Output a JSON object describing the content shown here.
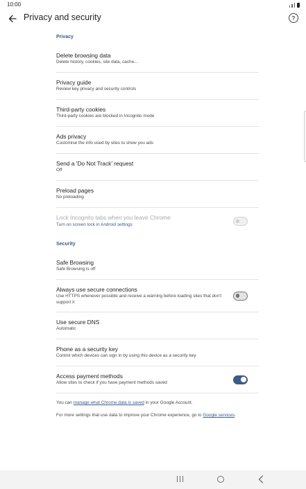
{
  "status_bar": {
    "time": "10:00"
  },
  "app_bar": {
    "title": "Privacy and security",
    "back_icon": "arrow-left-icon",
    "help_icon": "help-circle-icon",
    "help_glyph": "?"
  },
  "privacy": {
    "header": "Privacy",
    "items": [
      {
        "title": "Delete browsing data",
        "subtitle": "Delete history, cookies, site data, cache..."
      },
      {
        "title": "Privacy guide",
        "subtitle": "Review key privacy and security controls"
      },
      {
        "title": "Third-party cookies",
        "subtitle": "Third-party cookies are blocked in Incognito mode"
      },
      {
        "title": "Ads privacy",
        "subtitle": "Customise the info used by sites to show you ads"
      },
      {
        "title": "Send a 'Do Not Track' request",
        "subtitle": "Off"
      },
      {
        "title": "Preload pages",
        "subtitle": "No preloading"
      },
      {
        "title": "Lock Incognito tabs when you leave Chrome",
        "subtitle": "Turn on screen lock in Android settings",
        "toggle": "off",
        "disabled": true
      }
    ]
  },
  "security": {
    "header": "Security",
    "items": [
      {
        "title": "Safe Browsing",
        "subtitle": "Safe Browsing is off"
      },
      {
        "title": "Always use secure connections",
        "subtitle": "Use HTTPS whenever possible and receive a warning before loading sites that don't support it",
        "toggle": "off"
      },
      {
        "title": "Use secure DNS",
        "subtitle": "Automatic"
      },
      {
        "title": "Phone as a security key",
        "subtitle": "Control which devices can sign in by using this device as a security key."
      },
      {
        "title": "Access payment methods",
        "subtitle": "Allow sites to check if you have payment methods saved",
        "toggle": "on"
      }
    ]
  },
  "footer": {
    "account_prefix": "You can ",
    "account_link": "manage what Chrome data is saved",
    "account_suffix": " in your Google Account.",
    "services_prefix": "For more settings that use data to improve your Chrome experience, go to ",
    "services_link": "Google services",
    "services_suffix": "."
  },
  "colors": {
    "accent": "#3c5a8a",
    "text_primary": "#1f1f1f",
    "text_secondary": "#474747",
    "divider": "#e3e3e3",
    "nav_bar": "#f3f3f3"
  },
  "nav_bar": {
    "recents_icon": "recent-apps-icon",
    "home_icon": "home-circle-icon",
    "back_icon": "nav-back-chevron-icon"
  }
}
